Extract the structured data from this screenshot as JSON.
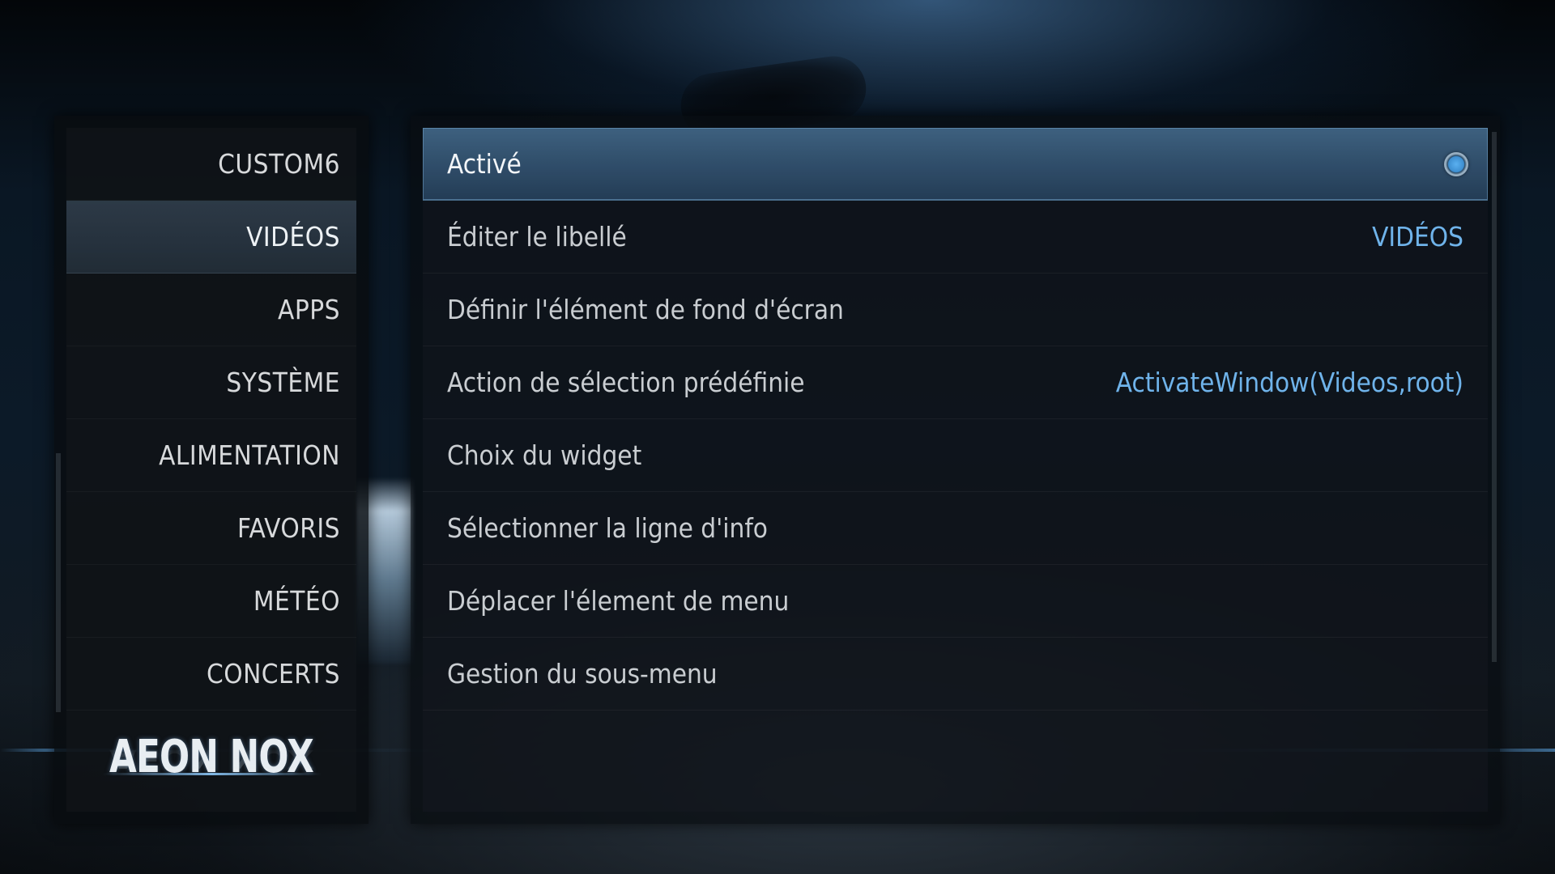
{
  "menu": {
    "items": [
      {
        "label": "CUSTOM6",
        "selected": false
      },
      {
        "label": "VIDÉOS",
        "selected": true
      },
      {
        "label": "APPS",
        "selected": false
      },
      {
        "label": "SYSTÈME",
        "selected": false
      },
      {
        "label": "ALIMENTATION",
        "selected": false
      },
      {
        "label": "FAVORIS",
        "selected": false
      },
      {
        "label": "MÉTÉO",
        "selected": false
      },
      {
        "label": "CONCERTS",
        "selected": false
      }
    ]
  },
  "logo": {
    "text": "AEON NOX"
  },
  "settings": {
    "rows": [
      {
        "label": "Activé",
        "value": "",
        "control": "radio-on",
        "focused": true
      },
      {
        "label": "Éditer le libellé",
        "value": "VIDÉOS"
      },
      {
        "label": "Définir l'élément de fond d'écran",
        "value": ""
      },
      {
        "label": "Action de sélection prédéfinie",
        "value": "ActivateWindow(Videos,root)"
      },
      {
        "label": "Choix du widget",
        "value": ""
      },
      {
        "label": "Sélectionner la ligne d'info",
        "value": ""
      },
      {
        "label": "Déplacer l'élement de menu",
        "value": ""
      },
      {
        "label": "Gestion du sous-menu",
        "value": ""
      }
    ]
  },
  "colors": {
    "accent": "#6fb3ea",
    "focus": "#3f6f96",
    "text": "#c9cdd1"
  },
  "icons": {
    "radio": "radio-on-icon"
  }
}
